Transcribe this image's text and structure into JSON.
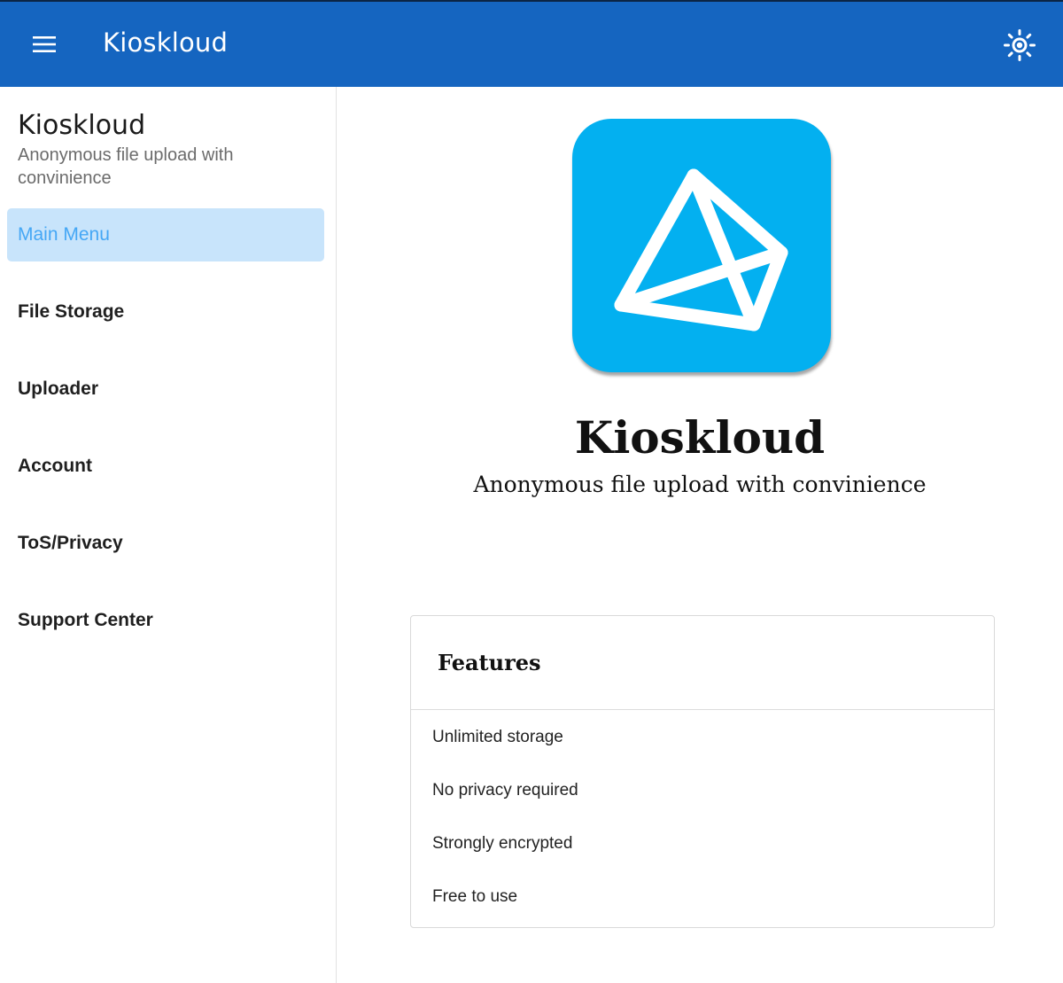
{
  "appbar": {
    "title": "Kioskloud",
    "menu_icon": "hamburger-menu-icon",
    "theme_icon": "sun-icon",
    "background": "#1565c0"
  },
  "sidebar": {
    "title": "Kioskloud",
    "subtitle": "Anonymous file upload with convinience",
    "items": [
      {
        "label": "Main Menu",
        "active": true
      },
      {
        "label": "File Storage",
        "active": false
      },
      {
        "label": "Uploader",
        "active": false
      },
      {
        "label": "Account",
        "active": false
      },
      {
        "label": "ToS/Privacy",
        "active": false
      },
      {
        "label": "Support Center",
        "active": false
      }
    ]
  },
  "main": {
    "logo_icon": "kioskloud-logo-icon",
    "logo_color": "#03b0f0",
    "title": "Kioskloud",
    "subtitle": "Anonymous file upload with convinience",
    "features_card": {
      "heading": "Features",
      "items": [
        "Unlimited storage",
        "No privacy required",
        "Strongly encrypted",
        "Free to use"
      ]
    }
  }
}
